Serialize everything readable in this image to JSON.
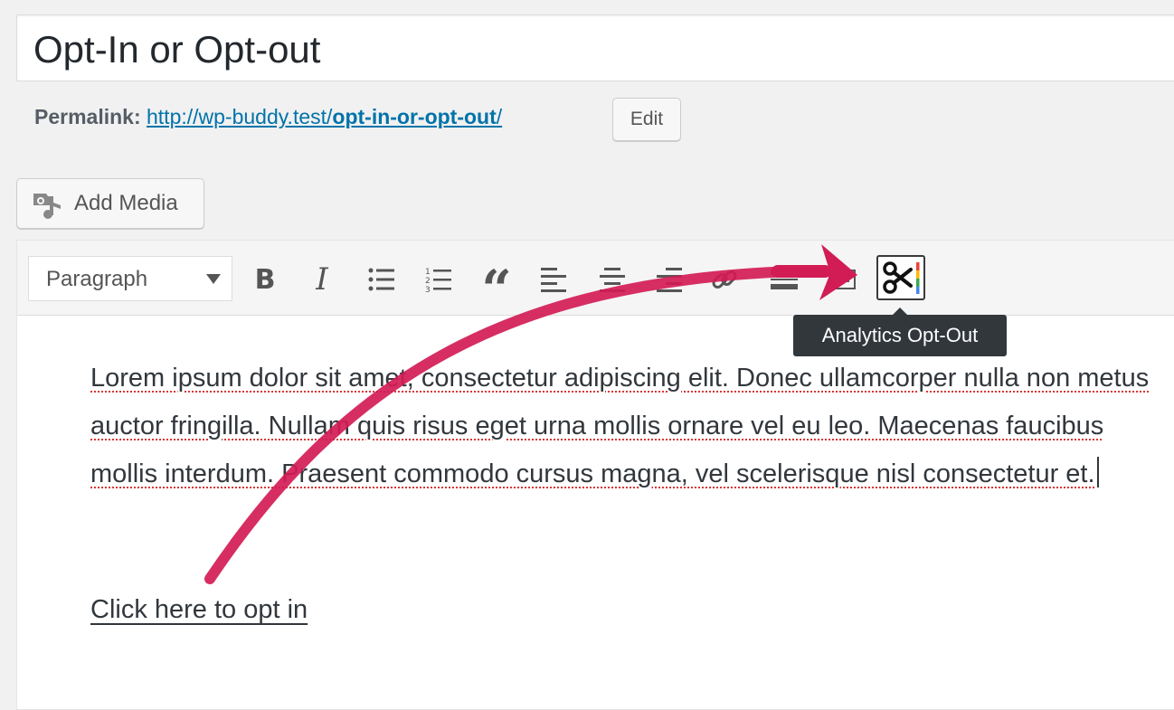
{
  "post": {
    "title": "Opt-In or Opt-out",
    "permalink_label": "Permalink:",
    "permalink_base": "http://wp-buddy.test/",
    "permalink_slug": "opt-in-or-opt-out",
    "permalink_end": "/",
    "edit_label": "Edit"
  },
  "media": {
    "add_media_label": "Add Media"
  },
  "toolbar": {
    "format_value": "Paragraph",
    "bold_glyph": "B",
    "italic_glyph": "I",
    "quote_glyph": "“",
    "buttons": [
      "bold",
      "italic",
      "bulleted-list",
      "numbered-list",
      "blockquote",
      "align-left",
      "align-center",
      "align-right",
      "insert-link",
      "read-more",
      "toolbar-toggle",
      "analytics-opt-out"
    ],
    "opt_out_tooltip": "Analytics Opt-Out"
  },
  "content": {
    "paragraph": "Lorem ipsum dolor sit amet, consectetur adipiscing elit. Donec ullamcorper nulla non metus auctor fringilla. Nullam quis risus eget urna mollis ornare vel eu leo. Maecenas faucibus mollis interdum. Praesent commodo cursus magna, vel scelerisque nisl consectetur et.",
    "link_text": "Click here to opt in"
  },
  "colors": {
    "link": "#0073aa",
    "annotation_arrow": "#d21c56",
    "tooltip_bg": "#32373c",
    "spellcheck_underline": "#d93636"
  }
}
